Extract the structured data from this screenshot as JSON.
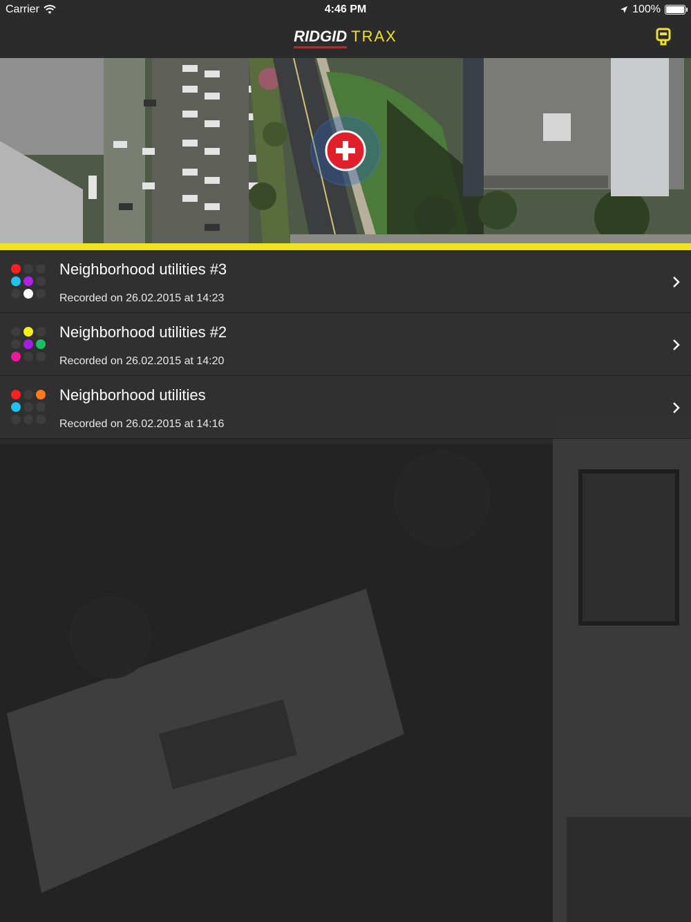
{
  "status_bar": {
    "carrier": "Carrier",
    "time": "4:46 PM",
    "battery": "100%"
  },
  "header": {
    "brand": "RIDGID",
    "app_name": "TRAX",
    "device_icon": "locator-device-icon"
  },
  "colors": {
    "accent_yellow": "#f2e31f",
    "brand_red": "#d81e1e",
    "add_button_red": "#e11f2a"
  },
  "recordings": [
    {
      "title": "Neighborhood utilities #3",
      "subtitle": "Recorded on 26.02.2015 at 14:23",
      "dot_colors": [
        "#ff1f1f",
        null,
        null,
        "#22c0ee",
        "#b022e6",
        null,
        null,
        "#ffffff",
        null
      ]
    },
    {
      "title": "Neighborhood utilities #2",
      "subtitle": "Recorded on 26.02.2015 at 14:20",
      "dot_colors": [
        null,
        "#f6f015",
        null,
        null,
        "#a020e6",
        "#18c060",
        "#f0189a",
        null,
        null
      ]
    },
    {
      "title": "Neighborhood utilities",
      "subtitle": "Recorded on 26.02.2015 at 14:16",
      "dot_colors": [
        "#ff1f1f",
        null,
        "#ff7a1a",
        "#22c0ee",
        null,
        null,
        null,
        null,
        null
      ]
    }
  ]
}
